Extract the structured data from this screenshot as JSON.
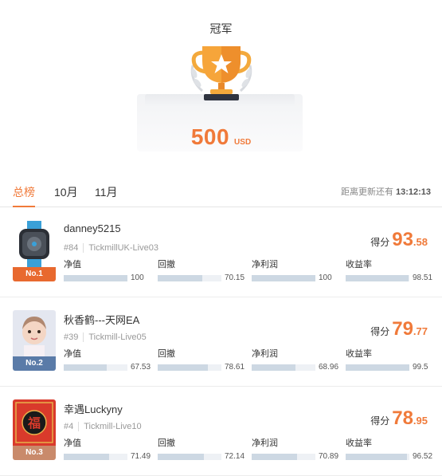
{
  "champion": {
    "title": "冠军",
    "prize_amount": "500",
    "prize_unit": "USD"
  },
  "tabs": {
    "items": [
      "总榜",
      "10月",
      "11月"
    ],
    "active": 0,
    "update_label": "距离更新还有",
    "update_time": "13:12:13"
  },
  "metric_labels": [
    "净值",
    "回撤",
    "净利润",
    "收益率"
  ],
  "score_label": "得分",
  "rows": [
    {
      "name": "danney5215",
      "rank_num": "#84",
      "account": "TickmillUK-Live03",
      "badge": "No.1",
      "score_int": "93",
      "score_dec": ".58",
      "metrics": [
        "100",
        "70.15",
        "100",
        "98.51"
      ],
      "fills": [
        1.0,
        0.7015,
        1.0,
        0.9851
      ],
      "avatar": "watch-avatar"
    },
    {
      "name": "秋香鹤---天网EA",
      "rank_num": "#39",
      "account": "Tickmill-Live05",
      "badge": "No.2",
      "score_int": "79",
      "score_dec": ".77",
      "metrics": [
        "67.53",
        "78.61",
        "68.96",
        "99.5"
      ],
      "fills": [
        0.6753,
        0.7861,
        0.6896,
        0.995
      ],
      "avatar": "child-avatar"
    },
    {
      "name": "幸遇Luckyny",
      "rank_num": "#4",
      "account": "Tickmill-Live10",
      "badge": "No.3",
      "score_int": "78",
      "score_dec": ".95",
      "metrics": [
        "71.49",
        "72.14",
        "70.89",
        "96.52"
      ],
      "fills": [
        0.7149,
        0.7214,
        0.7089,
        0.9652
      ],
      "avatar": "fu-avatar"
    }
  ],
  "colors": {
    "accent": "#f07a3a",
    "badge1": "#e8692f",
    "badge2": "#5a7ba8",
    "badge3": "#c98a6b",
    "bar_fill": "#cdd8e3",
    "bar_track": "#eef1f5"
  }
}
